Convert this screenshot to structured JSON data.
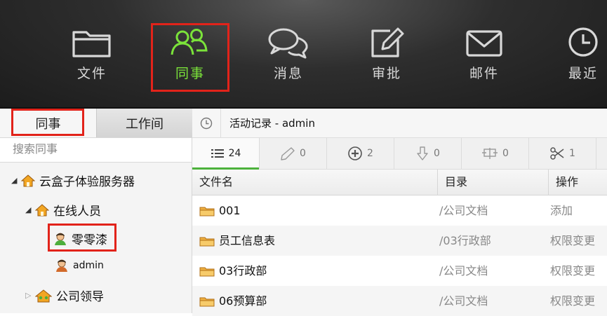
{
  "toolbar": {
    "items": [
      {
        "label": "文件",
        "icon": "folder-icon"
      },
      {
        "label": "同事",
        "icon": "colleagues-icon",
        "active": true
      },
      {
        "label": "消息",
        "icon": "chat-bubbles-icon"
      },
      {
        "label": "审批",
        "icon": "edit-icon"
      },
      {
        "label": "邮件",
        "icon": "mail-icon"
      },
      {
        "label": "最近",
        "icon": "clock-icon"
      }
    ],
    "active_color": "#7be33a",
    "highlight_color": "#e2231a"
  },
  "sidebar": {
    "tabs": [
      {
        "label": "同事"
      },
      {
        "label": "工作间"
      }
    ],
    "search_placeholder": "搜索同事",
    "tree": {
      "server": "云盒子体验服务器",
      "online_group": "在线人员",
      "users": [
        "零零漆",
        "admin"
      ],
      "group": "公司领导"
    }
  },
  "activity": {
    "title": "活动记录 - admin",
    "tabs": [
      {
        "icon": "list-icon",
        "count": "24"
      },
      {
        "icon": "pencil-icon",
        "count": "0"
      },
      {
        "icon": "plus-circle-icon",
        "count": "2"
      },
      {
        "icon": "download-icon",
        "count": "0"
      },
      {
        "icon": "move-icon",
        "count": "0"
      },
      {
        "icon": "scissors-icon",
        "count": "1"
      }
    ],
    "columns": [
      "文件名",
      "目录",
      "操作"
    ],
    "rows": [
      {
        "name": "001",
        "dir": "/公司文档",
        "op": "添加"
      },
      {
        "name": "员工信息表",
        "dir": "/03行政部",
        "op": "权限变更"
      },
      {
        "name": "03行政部",
        "dir": "/公司文档",
        "op": "权限变更"
      },
      {
        "name": "06预算部",
        "dir": "/公司文档",
        "op": "权限变更"
      }
    ]
  }
}
